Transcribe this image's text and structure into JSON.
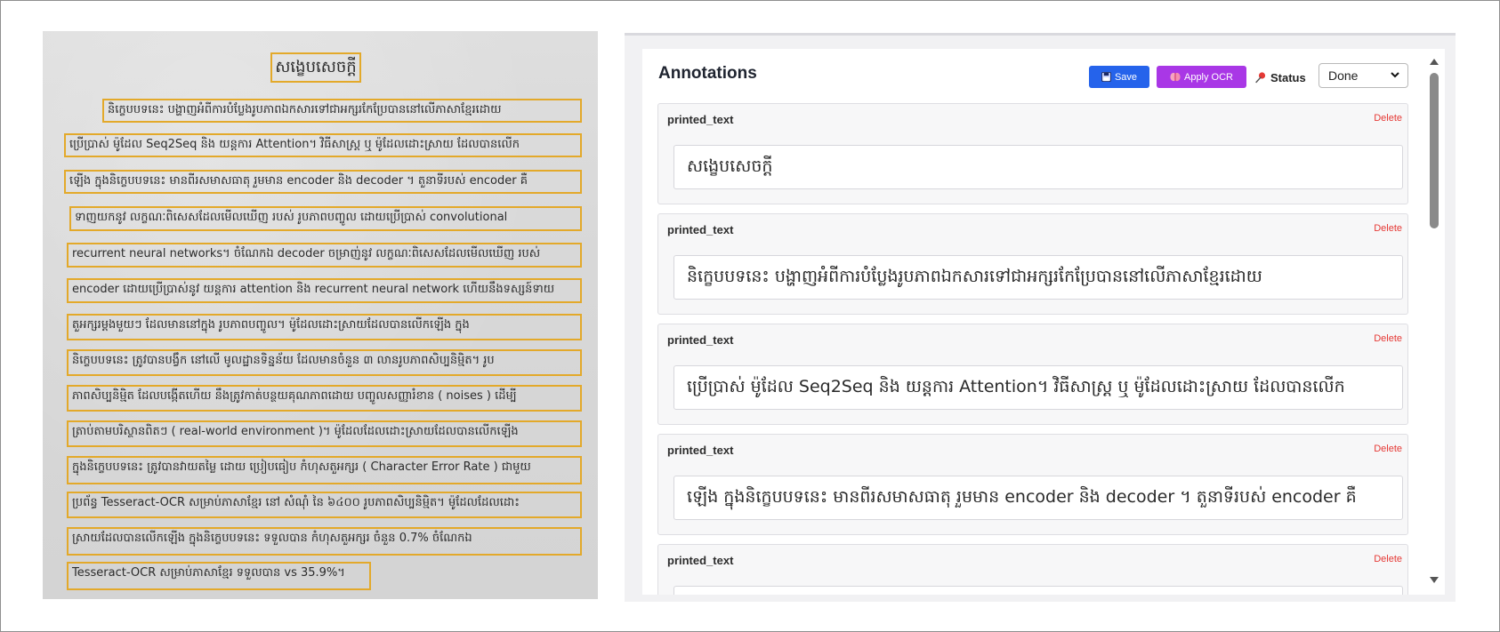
{
  "document": {
    "title": "សង្ខេបសេចក្ដី",
    "lines": [
      "និក្ខេបបទនេះ បង្ហាញអំពីការបំប្លែងរូបភាពឯកសារទៅជាអក្សរកែប្រែបាននៅលើភាសាខ្មែរដោយ",
      "ប្រើប្រាស់ ម៉ូដែល Seq2Seq និង យន្តការ Attention។ វិធីសាស្ត្រ ឬ ម៉ូដែលដោះស្រាយ ដែលបានលើក",
      "ឡើង ក្នុងនិក្ខេបបទនេះ មានពីរសមាសធាតុ រួមមាន encoder និង decoder ។ តួនាទីរបស់ encoder គឺ",
      "ទាញយកនូវ លក្ខណៈពិសេសដែលមើលឃើញ របស់ រូបភាពបញ្ចូល ដោយប្រើប្រាស់ convolutional",
      "recurrent neural networks។ ចំណែកឯ decoder ចម្រាញ់នូវ លក្ខណៈពិសេសដែលមើលឃើញ របស់",
      "encoder ដោយប្រើប្រាស់នូវ យន្តការ attention និង recurrent neural network ហើយនឹងទស្សន៍ទាយ",
      "តួអក្សរម្ដងមួយៗ ដែលមាននៅក្នុង រូបភាពបញ្ចូល។ ម៉ូដែលដោះស្រាយដែលបានលើកឡើង ក្នុង",
      "និក្ខេបបទនេះ ត្រូវបានបង្វឹក នៅលើ មូលដ្ឋានទិន្នន័យ ដែលមានចំនួន ៣ លានរូបភាពសិប្បនិម្មិត។ រូប",
      "ភាពសិប្បនិម្មិត ដែលបង្កើតហើយ នឹងត្រូវកាត់បន្ថយគុណភាពដោយ បញ្ចូលសញ្ញារំខាន ( noises ) ដើម្បី",
      "ត្រាប់តាមបរិស្ថានពិតៗ ( real-world environment )។ ម៉ូដែលដែលដោះស្រាយដែលបានលើកឡើង",
      "ក្នុងនិក្ខេបបទនេះ ត្រូវបានវាយតម្លៃ ដោយ ប្រៀបធៀប កំហុសតួអក្សរ ( Character Error Rate ) ជាមួយ",
      "ប្រព័ន្ធ Tesseract-OCR សម្រាប់ភាសាខ្មែរ នៅ សំណុំ នៃ ៦៤០០ រូបភាពសិប្បនិម្មិត។ ម៉ូដែលដែលដោះ",
      "ស្រាយដែលបានលើកឡើង ក្នុងនិក្ខេបបទនេះ ទទួលបាន កំហុសតួអក្សរ ចំនួន 0.7% ចំណែកឯ",
      "Tesseract-OCR សម្រាប់ភាសាខ្មែរ ទទួលបាន vs 35.9%។"
    ]
  },
  "panel": {
    "title": "Annotations",
    "save_label": "Save",
    "apply_ocr_label": "Apply OCR",
    "status_label": "Status",
    "status_value": "Done",
    "annotations": [
      {
        "type": "printed_text",
        "delete_label": "Delete",
        "text": "សង្ខេបសេចក្ដី"
      },
      {
        "type": "printed_text",
        "delete_label": "Delete",
        "text": "និក្ខេបបទនេះ បង្ហាញអំពីការបំប្លែងរូបភាពឯកសារទៅជាអក្សរកែប្រែបាននៅលើភាសាខ្មែរដោយ"
      },
      {
        "type": "printed_text",
        "delete_label": "Delete",
        "text": "ប្រើប្រាស់ ម៉ូដែល Seq2Seq និង យន្តការ Attention។ វិធីសាស្ត្រ ឬ ម៉ូដែលដោះស្រាយ ដែលបានលើក"
      },
      {
        "type": "printed_text",
        "delete_label": "Delete",
        "text": "ឡើង ក្នុងនិក្ខេបបទនេះ មានពីរសមាសធាតុ រួមមាន encoder និង decoder ។ តួនាទីរបស់ encoder គឺ"
      },
      {
        "type": "printed_text",
        "delete_label": "Delete",
        "text": ""
      }
    ]
  },
  "icons": {
    "save": "floppy-disk-icon",
    "ocr": "brain-icon",
    "status": "pushpin-icon"
  },
  "colors": {
    "bbox": "#e3a92a",
    "save_button": "#2563eb",
    "ocr_button": "#a937e6",
    "delete": "#e53935"
  }
}
